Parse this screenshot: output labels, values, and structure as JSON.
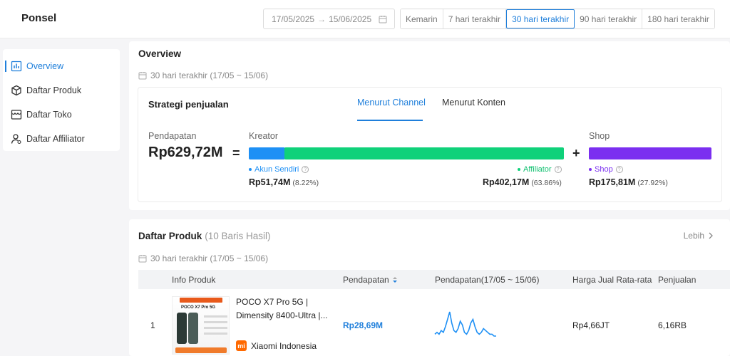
{
  "header": {
    "title": "Ponsel",
    "date_start": "17/05/2025",
    "date_end": "15/06/2025",
    "periods": [
      "Kemarin",
      "7 hari terakhir",
      "30 hari terakhir",
      "90 hari terakhir",
      "180 hari terakhir"
    ],
    "active_period": "30 hari terakhir"
  },
  "sidebar": {
    "items": [
      {
        "label": "Overview",
        "icon": "chart-icon",
        "active": true
      },
      {
        "label": "Daftar Produk",
        "icon": "box-icon",
        "active": false
      },
      {
        "label": "Daftar Toko",
        "icon": "store-icon",
        "active": false
      },
      {
        "label": "Daftar Affiliator",
        "icon": "user-icon",
        "active": false
      }
    ]
  },
  "overview": {
    "title": "Overview",
    "date_text": "30 hari terakhir (17/05 ~ 15/06)",
    "strategy": {
      "title": "Strategi penjualan",
      "tabs": [
        "Menurut Channel",
        "Menurut Konten"
      ],
      "active_tab": "Menurut Channel",
      "revenue_label": "Pendapatan",
      "revenue_value": "Rp629,72M",
      "equals": "=",
      "plus": "+",
      "creator_label": "Kreator",
      "shop_label": "Shop",
      "segments": {
        "akun": {
          "label": "Akun Sendiri",
          "value": "Rp51,74M",
          "pct": "(8.22%)",
          "share": 8.22,
          "color": "#1e90f5"
        },
        "affiliator": {
          "label": "Affiliator",
          "value": "Rp402,17M",
          "pct": "(63.86%)",
          "share": 63.86,
          "color": "#0fd17a"
        },
        "shop": {
          "label": "Shop",
          "value": "Rp175,81M",
          "pct": "(27.92%)",
          "share": 27.92,
          "color": "#7b2ff0"
        }
      }
    }
  },
  "products": {
    "title": "Daftar Produk",
    "count_text": "(10 Baris Hasil)",
    "more": "Lebih",
    "date_text": "30 hari terakhir (17/05 ~ 15/06)",
    "columns": [
      "Info Produk",
      "Pendapatan",
      "Pendapatan(17/05 ~ 15/06)",
      "Harga Jual Rata-rata",
      "Penjualan"
    ],
    "rows": [
      {
        "rank": "1",
        "thumb_brand": "POCO X7 Pro 5G",
        "name_line1": "POCO X7 Pro 5G |",
        "name_line2": "Dimensity 8400-Ultra |...",
        "shop": "Xiaomi Indonesia",
        "revenue": "Rp28,69M",
        "avg_price": "Rp4,66JT",
        "sales": "6,16RB",
        "trend": [
          2,
          3,
          2,
          4,
          3,
          6,
          10,
          14,
          8,
          4,
          3,
          5,
          9,
          7,
          3,
          2,
          4,
          8,
          10,
          6,
          3,
          2,
          3,
          5,
          4,
          3,
          2,
          2,
          1,
          1
        ]
      }
    ]
  }
}
